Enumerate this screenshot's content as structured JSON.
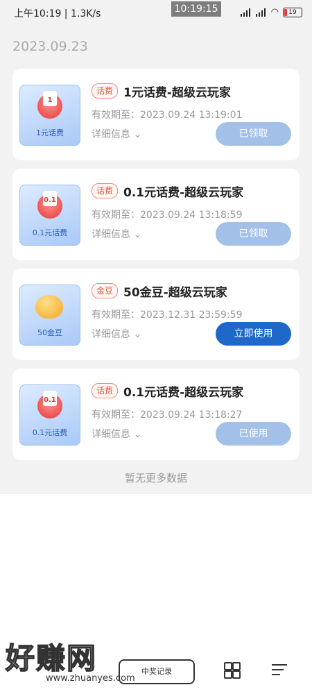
{
  "status_bar": {
    "left_text": "上午10:19 | 1.3K/s",
    "time_badge": "10:19:15",
    "battery": "19"
  },
  "date_header": "2023.09.23",
  "cards": [
    {
      "thumb_label": "1元话费",
      "thumb_value": "1",
      "tag": "话费",
      "title": "1元话费-超级云玩家",
      "expiry": "有效期至：2023.09.24 13:19:01",
      "detail": "详细信息",
      "button": "已领取",
      "button_state": "disabled"
    },
    {
      "thumb_label": "0.1元话费",
      "thumb_value": "0.1",
      "tag": "话费",
      "title": "0.1元话费-超级云玩家",
      "expiry": "有效期至：2023.09.24 13:18:59",
      "detail": "详细信息",
      "button": "已领取",
      "button_state": "disabled"
    },
    {
      "thumb_label": "50金豆",
      "thumb_value": "",
      "tag": "金豆",
      "title": "50金豆-超级云玩家",
      "expiry": "有效期至：2023.12.31 23:59:59",
      "detail": "详细信息",
      "button": "立即使用",
      "button_state": "active"
    },
    {
      "thumb_label": "0.1元话费",
      "thumb_value": "0.1",
      "tag": "话费",
      "title": "0.1元话费-超级云玩家",
      "expiry": "有效期至：2023.09.24 13:18:27",
      "detail": "详细信息",
      "button": "已使用",
      "button_state": "disabled"
    }
  ],
  "no_more": "暂无更多数据",
  "watermark": {
    "text": "好赚网",
    "url": "www.zhuanyes.com"
  },
  "nav": {
    "record_label": "中奖记录"
  },
  "colors": {
    "accent": "#1e68c9",
    "disabled_button": "#a2c0e8",
    "tag_red": "#e2553f",
    "page_bg": "#f2f2f2"
  }
}
